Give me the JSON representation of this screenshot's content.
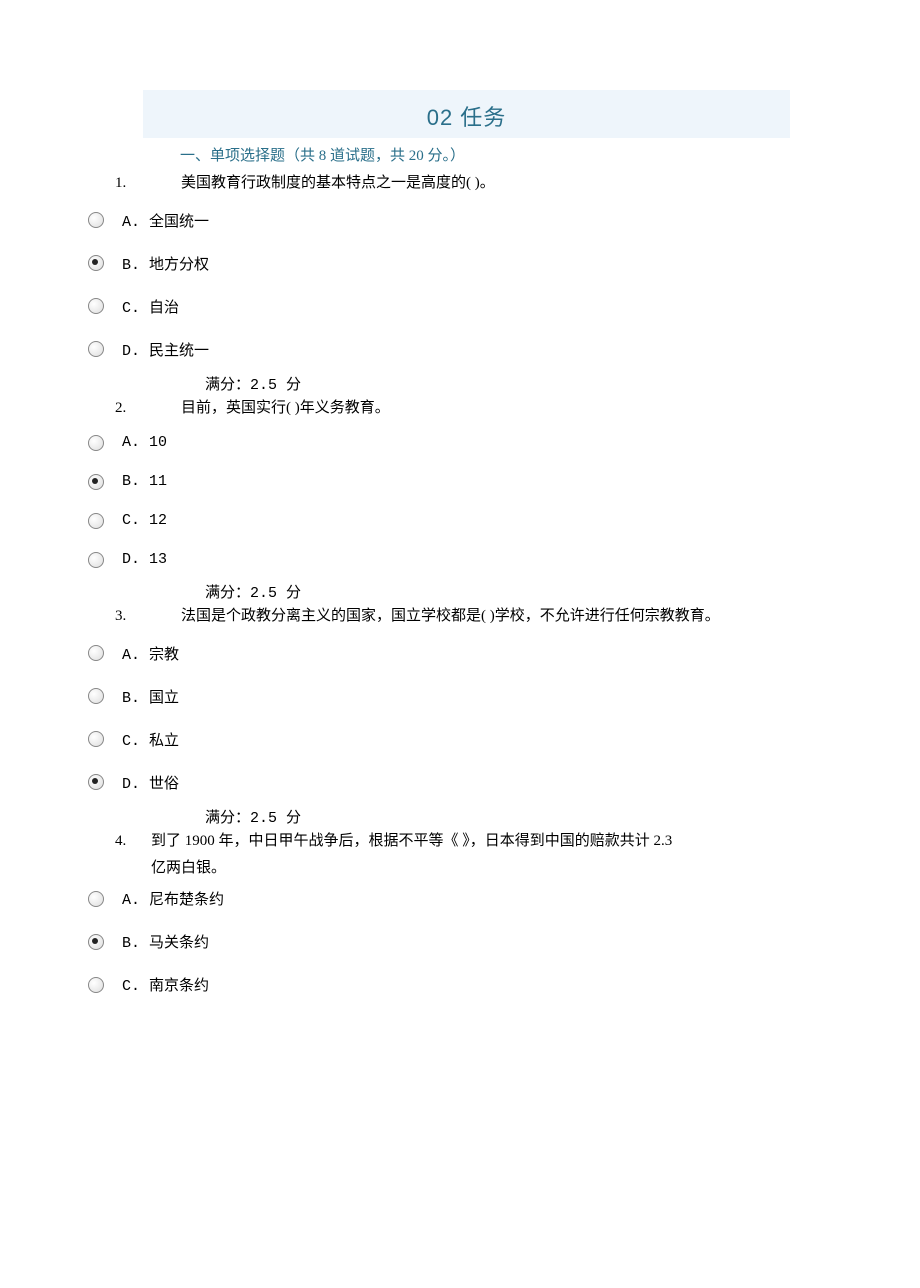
{
  "title": "02 任务",
  "section_head": "一、单项选择题（共  8  道试题，共  20  分。）",
  "score_label": "满分：2.5   分",
  "questions": [
    {
      "num": "1.",
      "text": "美国教育行政制度的基本特点之一是高度的( )。",
      "options": [
        {
          "label": "A. 全国统一",
          "selected": false
        },
        {
          "label": "B. 地方分权",
          "selected": true
        },
        {
          "label": "C. 自治",
          "selected": false
        },
        {
          "label": "D. 民主统一",
          "selected": false
        }
      ]
    },
    {
      "num": "2.",
      "text": "目前，英国实行( )年义务教育。",
      "options": [
        {
          "label": "A. 10",
          "selected": false
        },
        {
          "label": "B. 11",
          "selected": true
        },
        {
          "label": "C. 12",
          "selected": false
        },
        {
          "label": "D.   13",
          "selected": false
        }
      ]
    },
    {
      "num": "3.",
      "text": "法国是个政教分离主义的国家，国立学校都是( )学校，不允许进行任何宗教教育。",
      "options": [
        {
          "label": "A. 宗教",
          "selected": false
        },
        {
          "label": "B. 国立",
          "selected": false
        },
        {
          "label": "C. 私立",
          "selected": false
        },
        {
          "label": "D. 世俗",
          "selected": true
        }
      ]
    },
    {
      "num": "4.",
      "text_line1": "到了 1900 年，中日甲午战争后，根据不平等《    》，日本得到中国的赔款共计 2.3",
      "text_line2": "亿两白银。",
      "options": [
        {
          "label": "A. 尼布楚条约",
          "selected": false
        },
        {
          "label": "B. 马关条约",
          "selected": true
        },
        {
          "label": "C. 南京条约",
          "selected": false
        }
      ]
    }
  ]
}
